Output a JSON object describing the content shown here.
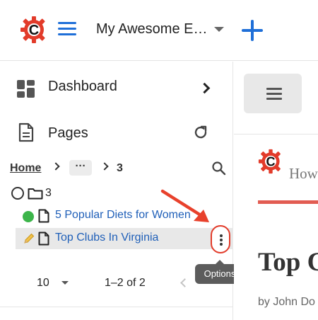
{
  "header": {
    "site_name": "My Awesome E…",
    "menu_icon": "hamburger-menu-icon",
    "add_icon": "plus-icon",
    "logo_icon": "gear-c-logo-icon"
  },
  "sidebar": {
    "nav": [
      {
        "label": "Dashboard",
        "icon": "dashboard-icon",
        "action_icon": "chevron-right-icon"
      },
      {
        "label": "Pages",
        "icon": "document-icon",
        "action_icon": "refresh-icon"
      }
    ],
    "breadcrumb": {
      "home": "Home",
      "more": "···",
      "current": "3"
    },
    "tree": {
      "root_label": "3",
      "items": [
        {
          "title": "5 Popular Diets for Women",
          "status": "published",
          "status_icon": "green-dot-icon"
        },
        {
          "title": "Top Clubs In Virginia",
          "status": "draft",
          "status_icon": "pencil-icon",
          "selected": true
        }
      ]
    },
    "options_tooltip": "Options",
    "pagination": {
      "per_page": "10",
      "range": "1–2 of 2"
    }
  },
  "preview": {
    "tagline": "How",
    "title": "Top C",
    "byline": "by John Do"
  },
  "colors": {
    "accent_blue": "#1f6fd8",
    "link_blue": "#1f5fb8",
    "brand_red": "#e23b2a",
    "published_green": "#3cb54a"
  }
}
